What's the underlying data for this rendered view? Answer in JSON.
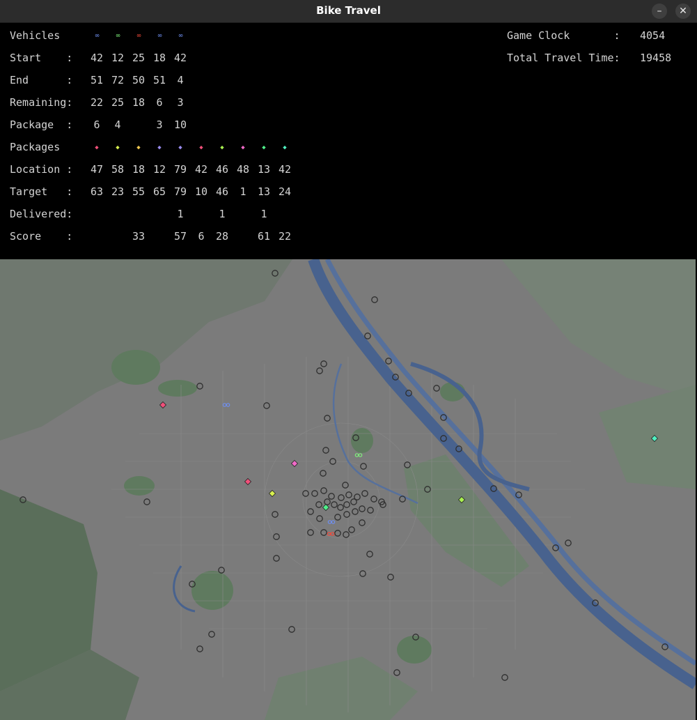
{
  "window": {
    "title": "Bike Travel",
    "min_label": "–",
    "close_label": "✕"
  },
  "hud": {
    "vehicles_label": "Vehicles",
    "vehicles": [
      {
        "color": "#6f8ff0",
        "icon": "bike-icon"
      },
      {
        "color": "#7ef07a",
        "icon": "bike-icon"
      },
      {
        "color": "#f04a3a",
        "icon": "bike-icon"
      },
      {
        "color": "#6f8ff0",
        "icon": "bike-icon"
      },
      {
        "color": "#6f8ff0",
        "icon": "bike-icon"
      }
    ],
    "start_label": "Start    :",
    "start": [
      "42",
      "12",
      "25",
      "18",
      "42"
    ],
    "end_label": "End      :",
    "end": [
      "51",
      "72",
      "50",
      "51",
      "4"
    ],
    "remaining_label": "Remaining:",
    "remaining": [
      "22",
      "25",
      "18",
      "6",
      "3"
    ],
    "package_label": "Package  :",
    "package": [
      "6",
      "4",
      "",
      "3",
      "10"
    ],
    "packages_label": "Packages",
    "packages": [
      {
        "color": "#f0507a",
        "icon": "diamond-icon"
      },
      {
        "color": "#d8f050",
        "icon": "diamond-icon"
      },
      {
        "color": "#f0c850",
        "icon": "diamond-icon"
      },
      {
        "color": "#9a8cf0",
        "icon": "diamond-icon"
      },
      {
        "color": "#9a8cf0",
        "icon": "diamond-icon"
      },
      {
        "color": "#f0507a",
        "icon": "diamond-icon"
      },
      {
        "color": "#a8f050",
        "icon": "diamond-icon"
      },
      {
        "color": "#f06ac8",
        "icon": "diamond-icon"
      },
      {
        "color": "#50f08a",
        "icon": "diamond-icon"
      },
      {
        "color": "#50f0c0",
        "icon": "diamond-icon"
      }
    ],
    "location_label": "Location :",
    "location": [
      "47",
      "58",
      "18",
      "12",
      "79",
      "42",
      "46",
      "48",
      "13",
      "42"
    ],
    "target_label": "Target   :",
    "target": [
      "63",
      "23",
      "55",
      "65",
      "79",
      "10",
      "46",
      "1",
      "13",
      "24"
    ],
    "delivered_label": "Delivered:",
    "delivered": [
      "",
      "",
      "",
      "",
      "1",
      "",
      "1",
      "",
      "1",
      ""
    ],
    "score_label": "Score    :",
    "score": [
      "",
      "",
      "33",
      "",
      "57",
      "6",
      "28",
      "",
      "61",
      "22"
    ],
    "game_clock_label": "Game Clock       :",
    "game_clock": "4054",
    "total_travel_label": "Total Travel Time:",
    "total_travel": "19458"
  }
}
